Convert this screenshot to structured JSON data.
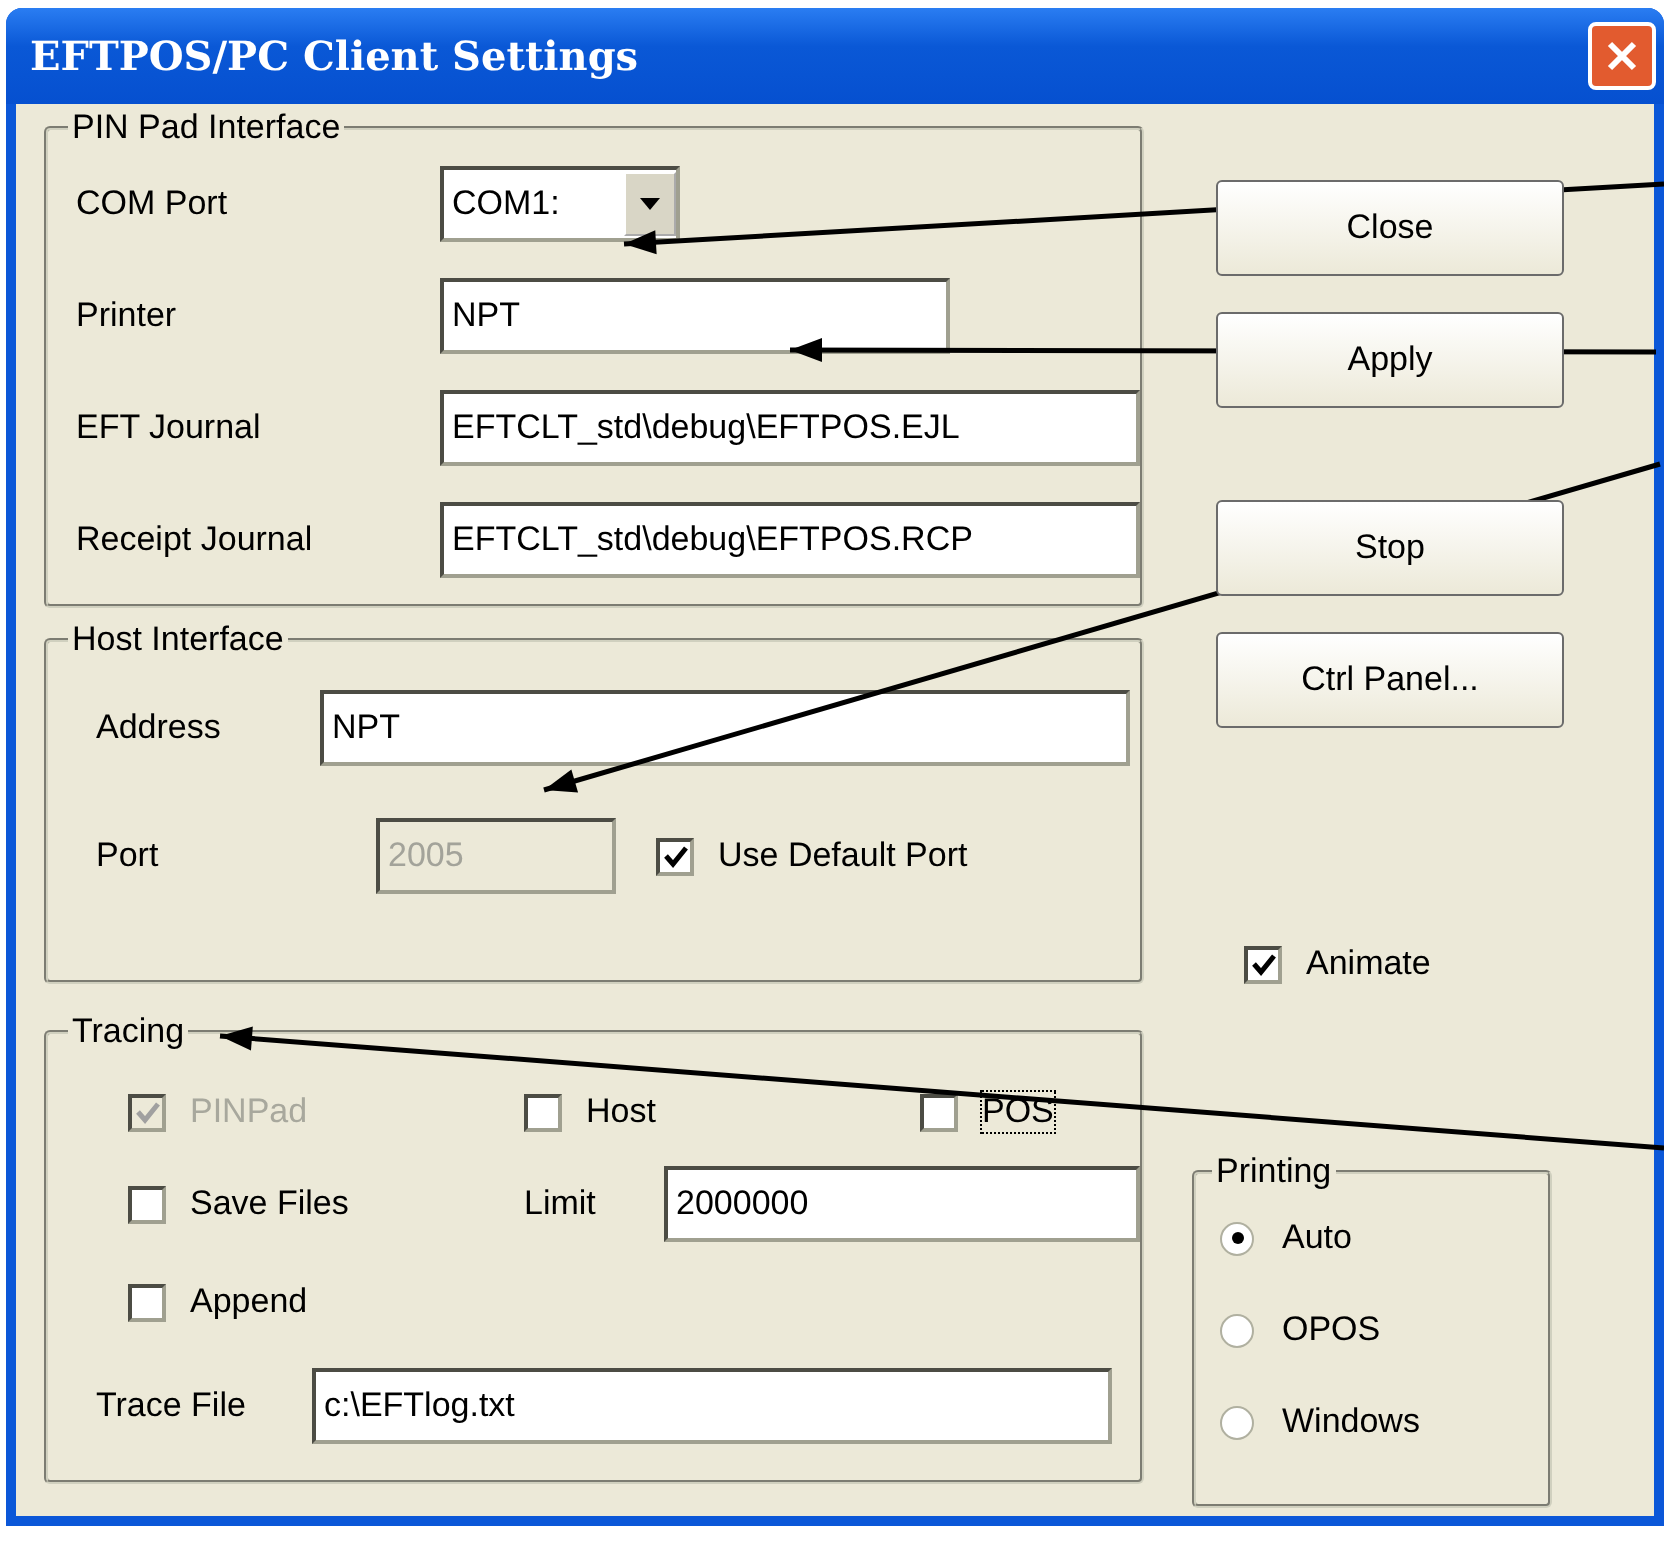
{
  "window": {
    "title": "EFTPOS/PC Client Settings"
  },
  "pin_pad": {
    "title": "PIN Pad Interface",
    "fields": [
      {
        "label": "COM Port",
        "kind": "dropdown",
        "value": "COM1:"
      },
      {
        "label": "Printer",
        "kind": "short",
        "value": "NPT"
      },
      {
        "label": "EFT Journal",
        "kind": "text",
        "value": "EFTCLT_std\\debug\\EFTPOS.EJL"
      },
      {
        "label": "Receipt Journal",
        "kind": "text",
        "value": "EFTCLT_std\\debug\\EFTPOS.RCP"
      }
    ]
  },
  "host": {
    "title": "Host Interface",
    "address": {
      "label": "Address",
      "value": "NPT"
    },
    "port": {
      "label": "Port",
      "value": "2005",
      "disabled": true
    },
    "use_default_port": {
      "label": "Use Default Port",
      "checked": true
    }
  },
  "tracing": {
    "title": "Tracing",
    "sources": [
      {
        "label": "PINPad",
        "checked": true,
        "disabled": true,
        "focused": false
      },
      {
        "label": "Host",
        "checked": false,
        "disabled": false,
        "focused": false
      },
      {
        "label": "POS",
        "checked": false,
        "disabled": false,
        "focused": true
      }
    ],
    "save_files": {
      "label": "Save Files",
      "checked": false
    },
    "limit": {
      "label": "Limit",
      "value": "2000000"
    },
    "append": {
      "label": "Append",
      "checked": false
    },
    "trace_file": {
      "label": "Trace File",
      "value": "c:\\EFTlog.txt"
    }
  },
  "buttons": [
    "Close",
    "Apply",
    "Stop",
    "Ctrl Panel..."
  ],
  "animate": {
    "label": "Animate",
    "checked": true
  },
  "printing": {
    "title": "Printing",
    "options": [
      {
        "label": "Auto",
        "selected": true
      },
      {
        "label": "OPOS",
        "selected": false
      },
      {
        "label": "Windows",
        "selected": false
      }
    ]
  }
}
